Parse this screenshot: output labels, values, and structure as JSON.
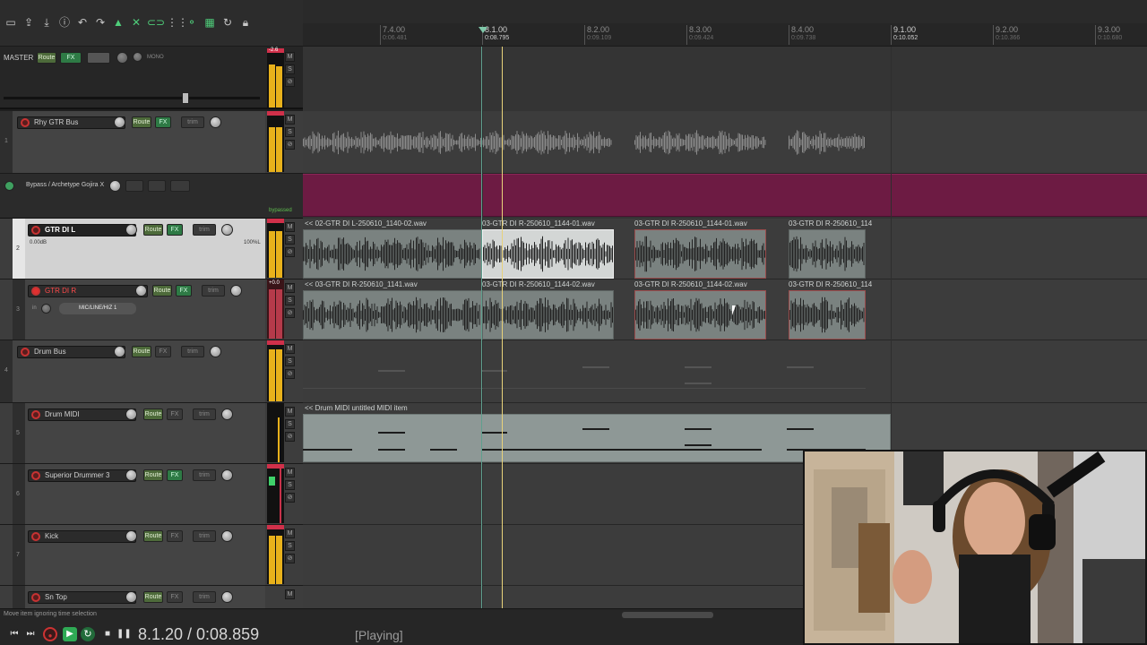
{
  "ruler": {
    "markers": [
      {
        "bar": "7.4.00",
        "time": "0:06.481"
      },
      {
        "bar": "8.1.00",
        "time": "0:08.795"
      },
      {
        "bar": "8.2.00",
        "time": "0:09.109"
      },
      {
        "bar": "8.3.00",
        "time": "0:09.424"
      },
      {
        "bar": "8.4.00",
        "time": "0:09.738"
      },
      {
        "bar": "9.1.00",
        "time": "0:10.052"
      },
      {
        "bar": "9.2.00",
        "time": "0:10.366"
      },
      {
        "bar": "9.3.00",
        "time": "0:10.680"
      }
    ]
  },
  "master": {
    "label": "MASTER",
    "route": "Route",
    "fx": "FX",
    "mono": "MONO",
    "peak": "-2.6"
  },
  "tracks": [
    {
      "num": "1",
      "name": "Rhy GTR Bus",
      "route": "Route",
      "fx": "FX",
      "trim": "trim"
    },
    {
      "num": "2",
      "name": "GTR DI L",
      "vol": "0.00dB",
      "pan": "100%L",
      "route": "Route",
      "fx": "FX",
      "trim": "trim"
    },
    {
      "num": "3",
      "name": "GTR DI R",
      "input": "MIC/LINE/HIZ 1",
      "in_label": "in",
      "route": "Route",
      "fx": "FX",
      "trim": "trim",
      "peak": "+0.0"
    },
    {
      "num": "4",
      "name": "Drum Bus",
      "route": "Route",
      "fx": "FX",
      "trim": "trim"
    },
    {
      "num": "5",
      "name": "Drum MIDI",
      "route": "Route",
      "fx": "FX",
      "trim": "trim"
    },
    {
      "num": "6",
      "name": "Superior Drummer 3",
      "route": "Route",
      "fx": "FX",
      "trim": "trim"
    },
    {
      "num": "7",
      "name": "Kick",
      "route": "Route",
      "fx": "FX",
      "trim": "trim"
    },
    {
      "num": "8",
      "name": "Sn Top",
      "route": "Route",
      "fx": "FX",
      "trim": "trim"
    }
  ],
  "fx_lane": {
    "name": "Bypass / Archetype Gojira X",
    "status": "bypassed"
  },
  "items": {
    "lane2": [
      "<< 02-GTR DI L-250610_1140-02.wav",
      "03-GTR DI R-250610_1144-01.wav",
      "03-GTR DI R-250610_1144-01.wav",
      "03-GTR DI R-250610_114"
    ],
    "lane3": [
      "<< 03-GTR DI R-250610_1141.wav",
      "03-GTR DI R-250610_1144-02.wav",
      "03-GTR DI R-250610_1144-02.wav",
      "03-GTR DI R-250610_114"
    ],
    "midi": "<< Drum MIDI untitled MIDI item"
  },
  "transport": {
    "hint": "Move item ignoring time selection",
    "position": "8.1.20 / 0:08.859",
    "status": "[Playing]"
  },
  "colors": {
    "accent_green": "#4fce7a",
    "playhead": "#e8d27a",
    "envelope": "#6d1b43",
    "meter": "#e8b11b"
  }
}
